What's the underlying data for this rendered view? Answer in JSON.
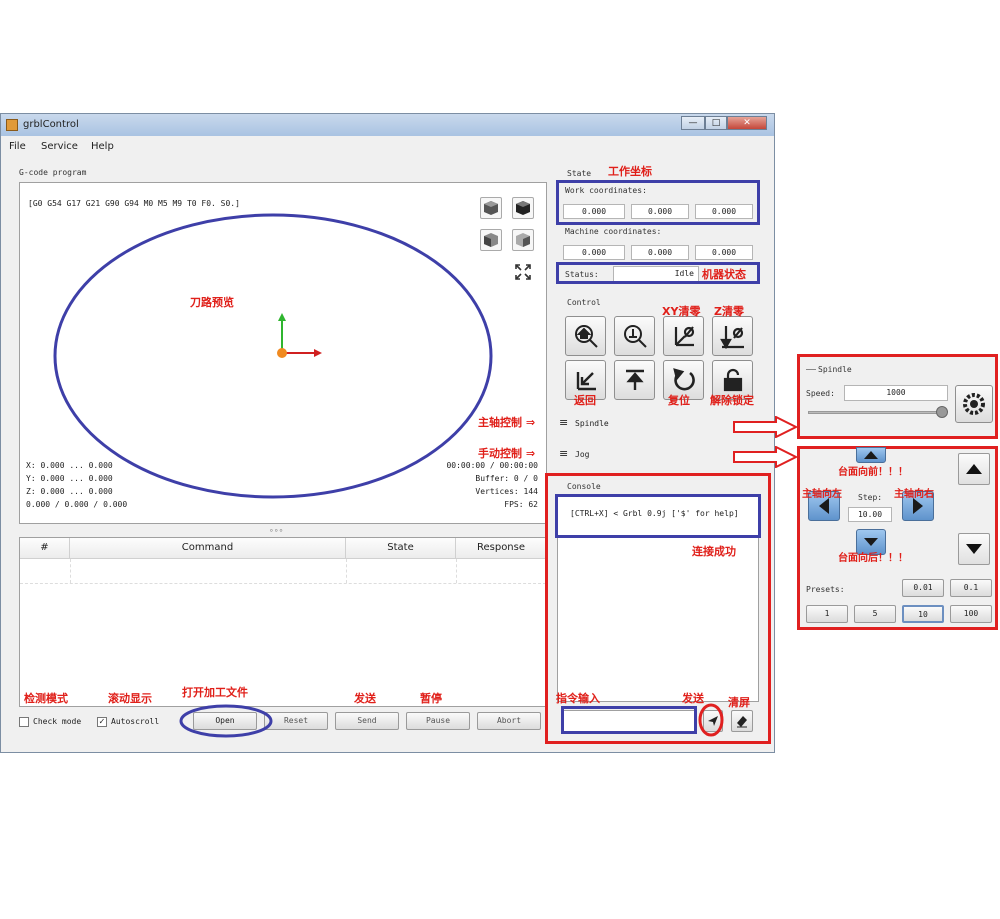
{
  "window": {
    "title": "grblControl",
    "minimize": "—",
    "maximize": "□",
    "close": "✕"
  },
  "menu": [
    "File",
    "Service",
    "Help"
  ],
  "gcode_program": {
    "label": "G-code program",
    "status_line": "[G0 G54 G17 G21 G90 G94 M0 M5 M9 T0 F0. S0.]",
    "stats_left": [
      "X: 0.000 ... 0.000",
      "Y: 0.000 ... 0.000",
      "Z: 0.000 ... 0.000",
      "0.000 / 0.000 / 0.000"
    ],
    "stats_right": [
      "00:00:00 / 00:00:00",
      "Buffer: 0 / 0",
      "Vertices: 144",
      "FPS: 62"
    ],
    "splitter": "∘∘∘"
  },
  "table": {
    "headers": [
      "#",
      "Command",
      "State",
      "Response"
    ]
  },
  "bottom_bar": {
    "check_mode": "Check mode",
    "autoscroll": "Autoscroll",
    "buttons": [
      "Open",
      "Reset",
      "Send",
      "Pause",
      "Abort"
    ]
  },
  "state": {
    "label": "State",
    "work_label": "Work coordinates:",
    "work": [
      "0.000",
      "0.000",
      "0.000"
    ],
    "machine_label": "Machine coordinates:",
    "machine": [
      "0.000",
      "0.000",
      "0.000"
    ],
    "status_label": "Status:",
    "status_value": "Idle"
  },
  "control": {
    "label": "Control"
  },
  "spindle_row": {
    "label": "Spindle",
    "icon": "≡"
  },
  "jog_row": {
    "label": "Jog",
    "icon": "≡"
  },
  "console": {
    "label": "Console",
    "text": "[CTRL+X] < Grbl 0.9j ['$' for help]"
  },
  "spindle_panel": {
    "label": "Spindle",
    "speed_label": "Speed:",
    "speed_value": "1000"
  },
  "jog_panel": {
    "step_label": "Step:",
    "step_value": "10.00",
    "presets_label": "Presets:",
    "presets_row1": [
      "0.01",
      "0.1"
    ],
    "presets_row2": [
      "1",
      "5",
      "10",
      "100"
    ]
  },
  "annotations": {
    "work_coords": "工作坐标",
    "machine_state": "机器状态",
    "path_preview": "刀路预览",
    "xy_zero": "XY清零",
    "z_zero": "Z清零",
    "return_home": "返回",
    "reset": "复位",
    "unlock": "解除锁定",
    "spindle_control": "主轴控制",
    "jog_control": "手动控制",
    "connected": "连接成功",
    "check_mode": "检测模式",
    "autoscroll": "滚动显示",
    "open_file": "打开加工文件",
    "send": "发送",
    "pause": "暂停",
    "cmd_input": "指令输入",
    "send2": "发送",
    "clear": "清屏",
    "forward": "台面向前！！！",
    "left": "主轴向左",
    "right": "主轴向右",
    "backward": "台面向后！！！",
    "arrow_symbol": "⇒"
  },
  "colors": {
    "annotation_red": "#e0201a",
    "annotation_blue": "#3e3fa8",
    "window_frame": "#7c8ea3"
  }
}
